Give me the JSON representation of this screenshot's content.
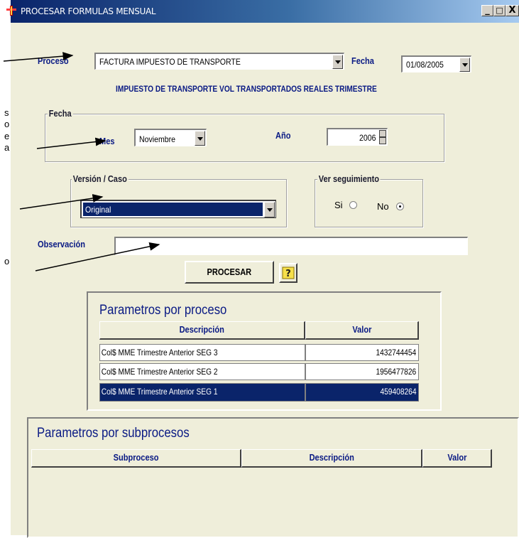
{
  "doc_letters": [
    "s",
    "o",
    "e",
    "a",
    "o"
  ],
  "window": {
    "title": "PROCESAR FORMULAS MENSUAL",
    "minimize": "_",
    "maximize": "□",
    "close": "X"
  },
  "proceso": {
    "label": "Proceso",
    "value": "FACTURA IMPUESTO DE TRANSPORTE"
  },
  "fecha_top": {
    "label": "Fecha",
    "value": "01/08/2005"
  },
  "description": "IMPUESTO DE TRANSPORTE VOL TRANSPORTADOS REALES TRIMESTRE",
  "fecha_group": {
    "legend": "Fecha",
    "mes_label": "Mes",
    "mes_value": "Noviembre",
    "anio_label": "Año",
    "anio_value": "2006"
  },
  "version": {
    "legend": "Versión / Caso",
    "value": "Original"
  },
  "seguimiento": {
    "legend": "Ver seguimiento",
    "si_label": "Si",
    "no_label": "No",
    "selected": "No"
  },
  "observacion": {
    "label": "Observación",
    "value": ""
  },
  "procesar_label": "PROCESAR",
  "parametros_proceso": {
    "title": "Parametros por proceso",
    "columns": [
      "Descripción",
      "Valor"
    ],
    "rows": [
      {
        "descripcion": "Col$ MME Trimestre Anterior SEG 3",
        "valor": "1432744454"
      },
      {
        "descripcion": "Col$ MME Trimestre Anterior SEG 2",
        "valor": "1956477826"
      },
      {
        "descripcion": "Col$ MME Trimestre Anterior SEG 1",
        "valor": "459408264"
      }
    ],
    "selected_row": 2
  },
  "parametros_subprocesos": {
    "title": "Parametros por subprocesos",
    "columns": [
      "Subproceso",
      "Descripción",
      "Valor"
    ]
  }
}
